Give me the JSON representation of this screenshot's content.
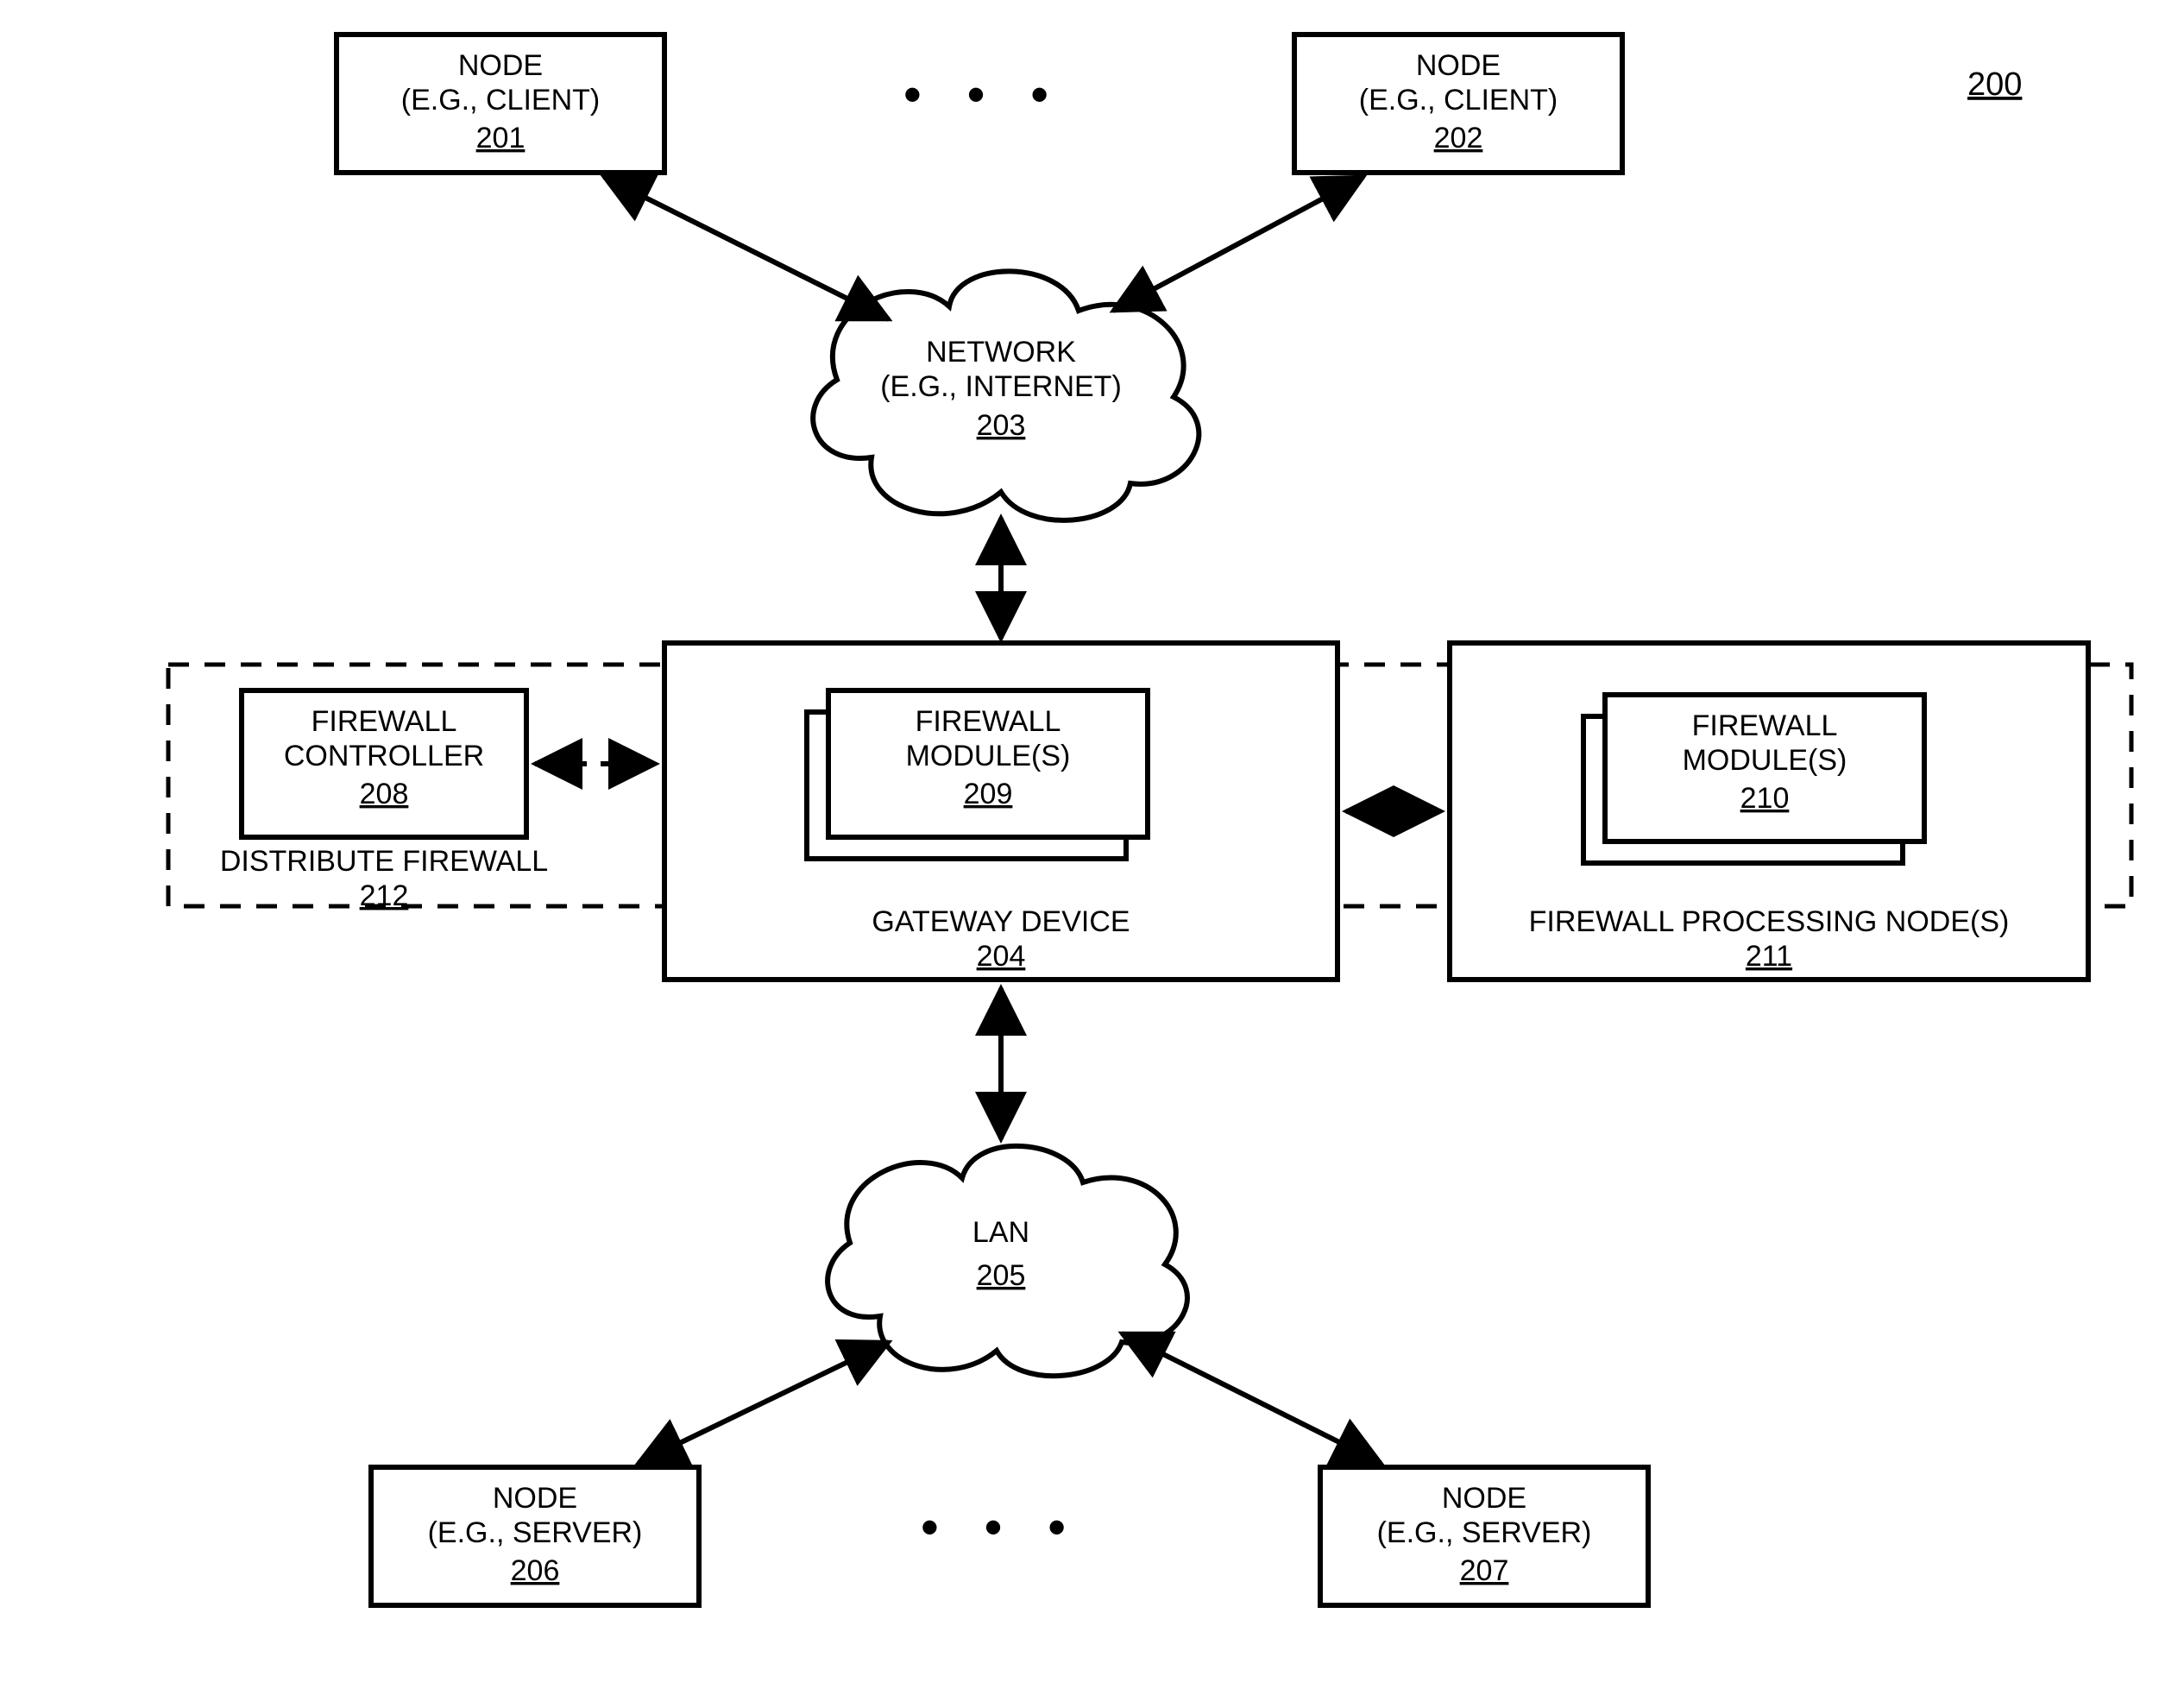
{
  "figure_ref": "200",
  "ellipsis": "• • •",
  "nodes": {
    "client1": {
      "l1": "NODE",
      "l2": "(E.G., CLIENT)",
      "ref": "201"
    },
    "client2": {
      "l1": "NODE",
      "l2": "(E.G., CLIENT)",
      "ref": "202"
    },
    "network": {
      "l1": "NETWORK",
      "l2": "(E.G., INTERNET)",
      "ref": "203"
    },
    "gateway": {
      "label": "GATEWAY DEVICE",
      "ref": "204"
    },
    "fw_controller": {
      "l1": "FIREWALL",
      "l2": "CONTROLLER",
      "ref": "208"
    },
    "fw_modules_gw": {
      "l1": "FIREWALL",
      "l2": "MODULE(S)",
      "ref": "209"
    },
    "fw_modules_proc": {
      "l1": "FIREWALL",
      "l2": "MODULE(S)",
      "ref": "210"
    },
    "fw_proc_node": {
      "label": "FIREWALL PROCESSING NODE(S)",
      "ref": "211"
    },
    "dist_fw": {
      "label": "DISTRIBUTE FIREWALL",
      "ref": "212"
    },
    "lan": {
      "l1": "LAN",
      "ref": "205"
    },
    "server1": {
      "l1": "NODE",
      "l2": "(E.G., SERVER)",
      "ref": "206"
    },
    "server2": {
      "l1": "NODE",
      "l2": "(E.G., SERVER)",
      "ref": "207"
    }
  }
}
